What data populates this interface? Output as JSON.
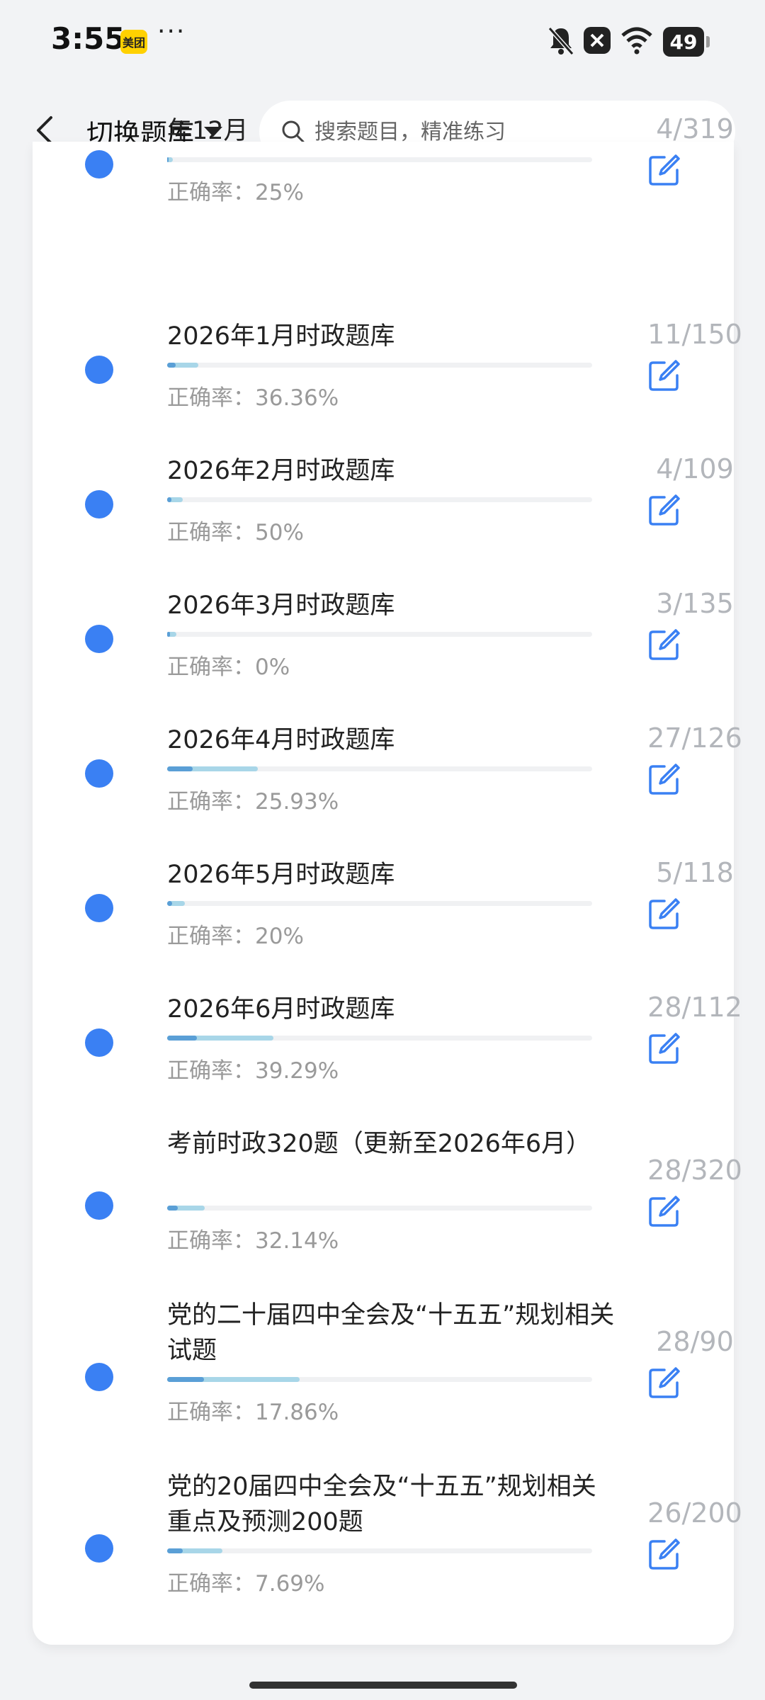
{
  "status_bar": {
    "time": "3:55",
    "app_badge": "美团",
    "more": "···",
    "battery": "49"
  },
  "header": {
    "switch_label": "切换题库",
    "search_placeholder": "搜索题目，精准练习"
  },
  "colors": {
    "accent": "#3a80f3",
    "progress_light": "#a8d6e8",
    "progress_dark": "#5a9fd6",
    "muted_text": "#9a9a9a"
  },
  "accuracy_prefix": "正确率：",
  "items": [
    {
      "title": "年12月",
      "count": "4/319",
      "accuracy": "25%",
      "progress": 0.0125
    },
    {
      "title": "2026年1月时政题库",
      "count": "11/150",
      "accuracy": "36.36%",
      "progress": 0.073
    },
    {
      "title": "2026年2月时政题库",
      "count": "4/109",
      "accuracy": "50%",
      "progress": 0.037
    },
    {
      "title": "2026年3月时政题库",
      "count": "3/135",
      "accuracy": "0%",
      "progress": 0.022
    },
    {
      "title": "2026年4月时政题库",
      "count": "27/126",
      "accuracy": "25.93%",
      "progress": 0.214
    },
    {
      "title": "2026年5月时政题库",
      "count": "5/118",
      "accuracy": "20%",
      "progress": 0.042
    },
    {
      "title": "2026年6月时政题库",
      "count": "28/112",
      "accuracy": "39.29%",
      "progress": 0.25
    },
    {
      "title": "考前时政320题（更新至2026年6月）",
      "count": "28/320",
      "accuracy": "32.14%",
      "progress": 0.0875
    },
    {
      "title": "党的二十届四中全会及“十五五”规划相关试题",
      "count": "28/90",
      "accuracy": "17.86%",
      "progress": 0.311
    },
    {
      "title": "党的20届四中全会及“十五五”规划相关重点及预测200题",
      "count": "26/200",
      "accuracy": "7.69%",
      "progress": 0.13
    }
  ]
}
